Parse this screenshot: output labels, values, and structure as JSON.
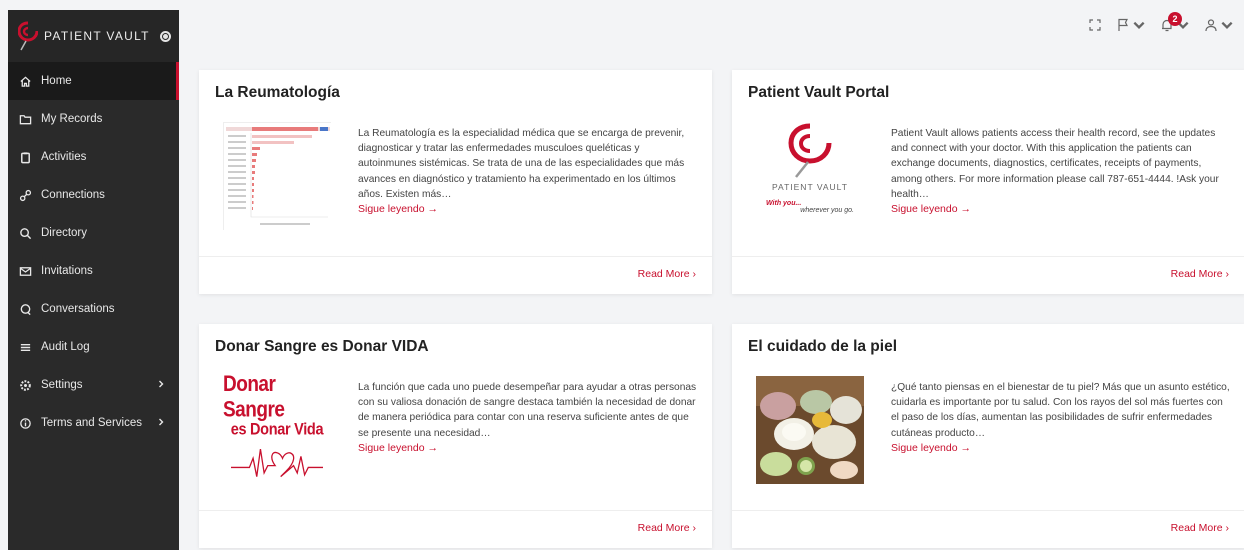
{
  "brand": {
    "name": "PATIENT VAULT",
    "accent": "#c8102e"
  },
  "sidebar": {
    "items": [
      {
        "label": "Home",
        "icon": "home-icon",
        "active": true
      },
      {
        "label": "My Records",
        "icon": "folder-icon"
      },
      {
        "label": "Activities",
        "icon": "clipboard-icon"
      },
      {
        "label": "Connections",
        "icon": "link-icon"
      },
      {
        "label": "Directory",
        "icon": "search-icon"
      },
      {
        "label": "Invitations",
        "icon": "mail-icon"
      },
      {
        "label": "Conversations",
        "icon": "chat-icon"
      },
      {
        "label": "Audit Log",
        "icon": "list-icon"
      },
      {
        "label": "Settings",
        "icon": "gear-icon",
        "chevron": true
      },
      {
        "label": "Terms and Services",
        "icon": "info-icon",
        "chevron": true
      }
    ]
  },
  "topbar": {
    "notifications_count": "2"
  },
  "cards": [
    {
      "title": "La Reumatología",
      "text": "La Reumatología es la especialidad médica que se encarga de prevenir, diagnosticar y tratar las  enfermedades musculoes queléticas  y autoinmunes sistémicas. Se trata de una de las especialidades que más avances en diagnóstico y tratamiento ha experimentado en los últimos años. Existen más…",
      "more": "Sigue leyendo →",
      "read_more": "Read More ›"
    },
    {
      "title": "Patient Vault Portal",
      "text": "Patient Vault allows patients access their health record, see the updates and connect with your doctor. With this application the patients can exchange documents, diagnostics, certificates, receipts of payments, among others.  For more information please call 787-651-4444.  !Ask your health…",
      "more": "Sigue leyendo →",
      "read_more": "Read More ›",
      "thumb_brand": "PATIENT VAULT",
      "thumb_with": "With you...",
      "thumb_wherever": "wherever you go."
    },
    {
      "title": "Donar Sangre es Donar VIDA",
      "text": "La función que cada uno puede desempeñar para ayudar a otras personas con su valiosa donación de sangre destaca también la necesidad de donar de manera periódica para contar con una reserva suficiente antes de que se presente una necesidad…",
      "more": "Sigue leyendo →",
      "read_more": "Read More ›",
      "thumb_line1": "Donar Sangre",
      "thumb_line2": "es Donar Vida"
    },
    {
      "title": "El cuidado de la piel",
      "text": "¿Qué tanto piensas en el bienestar de tu piel? Más que un asunto estético, cuidarla es importante por tu salud. Con los rayos del sol más fuertes con el paso de los días, aumentan las posibilidades de sufrir enfermedades cutáneas producto…",
      "more": "Sigue leyendo →",
      "read_more": "Read More ›"
    }
  ]
}
